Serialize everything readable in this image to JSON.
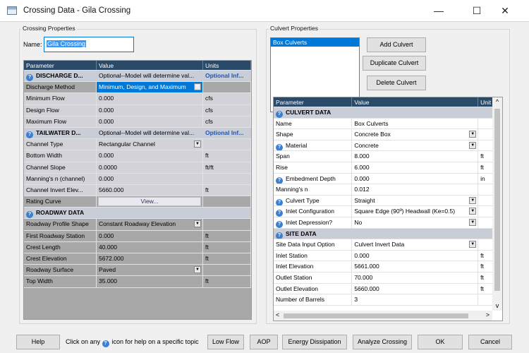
{
  "window": {
    "title": "Crossing Data - Gila Crossing"
  },
  "crossing": {
    "group_title": "Crossing Properties",
    "name_label": "Name:",
    "name_value": "Gila Crossing",
    "headers": [
      "Parameter",
      "Value",
      "Units"
    ],
    "rows": [
      {
        "type": "section",
        "param": "DISCHARGE D...",
        "value": "Optional--Model will determine val...",
        "units": "Optional Inf..."
      },
      {
        "type": "field",
        "param": "Discharge Method",
        "value": "Minimum, Design, and Maximum",
        "units": "",
        "dropdown": true,
        "selected": true
      },
      {
        "type": "field",
        "param": "Minimum Flow",
        "value": "0.000",
        "units": "cfs",
        "readonly": true
      },
      {
        "type": "field",
        "param": "Design Flow",
        "value": "0.000",
        "units": "cfs",
        "readonly": true
      },
      {
        "type": "field",
        "param": "Maximum Flow",
        "value": "0.000",
        "units": "cfs",
        "readonly": true
      },
      {
        "type": "section",
        "param": "TAILWATER D...",
        "value": "Optional--Model will determine val...",
        "units": "Optional Inf..."
      },
      {
        "type": "field",
        "param": "Channel Type",
        "value": "Rectangular Channel",
        "units": "",
        "dropdown": true,
        "readonly": true
      },
      {
        "type": "field",
        "param": "Bottom Width",
        "value": "0.000",
        "units": "ft",
        "readonly": true
      },
      {
        "type": "field",
        "param": "Channel Slope",
        "value": "0.0000",
        "units": "ft/ft",
        "readonly": true
      },
      {
        "type": "field",
        "param": "Manning's n (channel)",
        "value": "0.000",
        "units": "",
        "readonly": true
      },
      {
        "type": "field",
        "param": "Channel Invert Elev...",
        "value": "5660.000",
        "units": "ft",
        "readonly": true
      },
      {
        "type": "field",
        "param": "Rating Curve",
        "value": "View...",
        "units": "",
        "button": true
      },
      {
        "type": "section",
        "param": "ROADWAY DATA",
        "value": "",
        "units": ""
      },
      {
        "type": "field",
        "param": "Roadway Profile Shape",
        "value": "Constant Roadway Elevation",
        "units": "",
        "dropdown": true
      },
      {
        "type": "field",
        "param": "First Roadway Station",
        "value": "0.000",
        "units": "ft"
      },
      {
        "type": "field",
        "param": "Crest Length",
        "value": "40.000",
        "units": "ft"
      },
      {
        "type": "field",
        "param": "Crest Elevation",
        "value": "5672.000",
        "units": "ft"
      },
      {
        "type": "field",
        "param": "Roadway Surface",
        "value": "Paved",
        "units": "",
        "dropdown": true
      },
      {
        "type": "field",
        "param": "Top Width",
        "value": "35.000",
        "units": "ft"
      }
    ]
  },
  "culvert": {
    "group_title": "Culvert Properties",
    "list_items": [
      "Box Culverts"
    ],
    "add_label": "Add Culvert",
    "duplicate_label": "Duplicate Culvert",
    "delete_label": "Delete Culvert",
    "headers": [
      "Parameter",
      "Value",
      "Unit"
    ],
    "rows": [
      {
        "type": "section",
        "param": "CULVERT DATA",
        "value": "",
        "units": ""
      },
      {
        "type": "field",
        "param": "Name",
        "value": "Box Culverts",
        "units": ""
      },
      {
        "type": "field",
        "param": "Shape",
        "value": "Concrete Box",
        "units": "",
        "dropdown": true
      },
      {
        "type": "field",
        "param": "Material",
        "value": "Concrete",
        "units": "",
        "dropdown": true,
        "icon": true
      },
      {
        "type": "field",
        "param": "Span",
        "value": "8.000",
        "units": "ft"
      },
      {
        "type": "field",
        "param": "Rise",
        "value": "6.000",
        "units": "ft"
      },
      {
        "type": "field",
        "param": "Embedment Depth",
        "value": "0.000",
        "units": "in",
        "icon": true
      },
      {
        "type": "field",
        "param": "Manning's n",
        "value": "0.012",
        "units": ""
      },
      {
        "type": "field",
        "param": "Culvert Type",
        "value": "Straight",
        "units": "",
        "dropdown": true,
        "icon": true
      },
      {
        "type": "field",
        "param": "Inlet Configuration",
        "value": "Square Edge (90º) Headwall (Ke=0.5)",
        "units": "",
        "dropdown": true,
        "icon": true
      },
      {
        "type": "field",
        "param": "Inlet Depression?",
        "value": "No",
        "units": "",
        "dropdown": true,
        "icon": true
      },
      {
        "type": "section",
        "param": "SITE DATA",
        "value": "",
        "units": ""
      },
      {
        "type": "field",
        "param": "Site Data Input Option",
        "value": "Culvert Invert Data",
        "units": "",
        "dropdown": true
      },
      {
        "type": "field",
        "param": "Inlet Station",
        "value": "0.000",
        "units": "ft"
      },
      {
        "type": "field",
        "param": "Inlet Elevation",
        "value": "5661.000",
        "units": "ft"
      },
      {
        "type": "field",
        "param": "Outlet Station",
        "value": "70.000",
        "units": "ft"
      },
      {
        "type": "field",
        "param": "Outlet Elevation",
        "value": "5660.000",
        "units": "ft"
      },
      {
        "type": "field",
        "param": "Number of Barrels",
        "value": "3",
        "units": ""
      }
    ]
  },
  "bottom": {
    "help_label": "Help",
    "hint_prefix": "Click on any",
    "hint_suffix": "icon for help on a specific topic",
    "low_flow_label": "Low Flow",
    "aop_label": "AOP",
    "energy_label": "Energy Dissipation",
    "analyze_label": "Analyze Crossing",
    "ok_label": "OK",
    "cancel_label": "Cancel"
  },
  "icons": {
    "help": "?",
    "minimize": "—",
    "maximize": "☐",
    "close": "✕",
    "dropdown": "▼",
    "scroll_up": "^",
    "scroll_down": "v",
    "scroll_left": "<",
    "scroll_right": ">"
  }
}
